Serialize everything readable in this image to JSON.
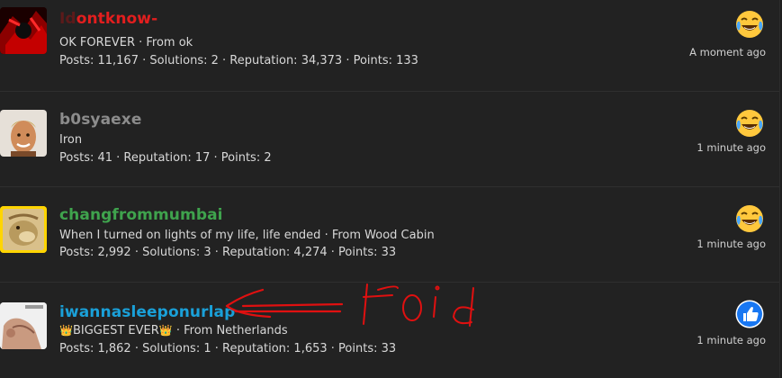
{
  "colors": {
    "background": "#222222",
    "user1_name_dark": "#5c1a1a",
    "user1_name_red": "#e21e1e",
    "user2_name": "#8c8c8c",
    "user3_name": "#3fa34d",
    "user4_name": "#1aa0d8",
    "annotation": "#e01010"
  },
  "rows": [
    {
      "username_part1": "Id",
      "username_part2": "ontknow-",
      "title": "OK FOREVER · From ok",
      "stats": "Posts: 11,167 · Solutions: 2 · Reputation: 34,373 · Points: 133",
      "time": "A moment ago",
      "reaction_icon": "laughing-crying-emoji-icon"
    },
    {
      "username": "b0syaexe",
      "title": "Iron",
      "stats": "Posts: 41 · Reputation: 17 · Points: 2",
      "time": "1 minute ago",
      "reaction_icon": "laughing-crying-emoji-icon"
    },
    {
      "username": "changfrommumbai",
      "title": "When I turned on lights of my life, life ended · From Wood Cabin",
      "stats": "Posts: 2,992 · Solutions: 3 · Reputation: 4,274 · Points: 33",
      "time": "1 minute ago",
      "reaction_icon": "laughing-crying-emoji-icon"
    },
    {
      "username": "iwannasleeponurlap",
      "title_crown_left": "👑",
      "title_text": "BIGGEST EVER",
      "title_crown_right": "👑",
      "title_from": " · From Netherlands",
      "stats": "Posts: 1,862 · Solutions: 1 · Reputation: 1,653 · Points: 33",
      "time": "1 minute ago",
      "reaction_icon": "thumbs-up-icon"
    }
  ],
  "annotation": {
    "text": "foid",
    "arrow_icon": "hand-drawn-arrow-icon"
  }
}
